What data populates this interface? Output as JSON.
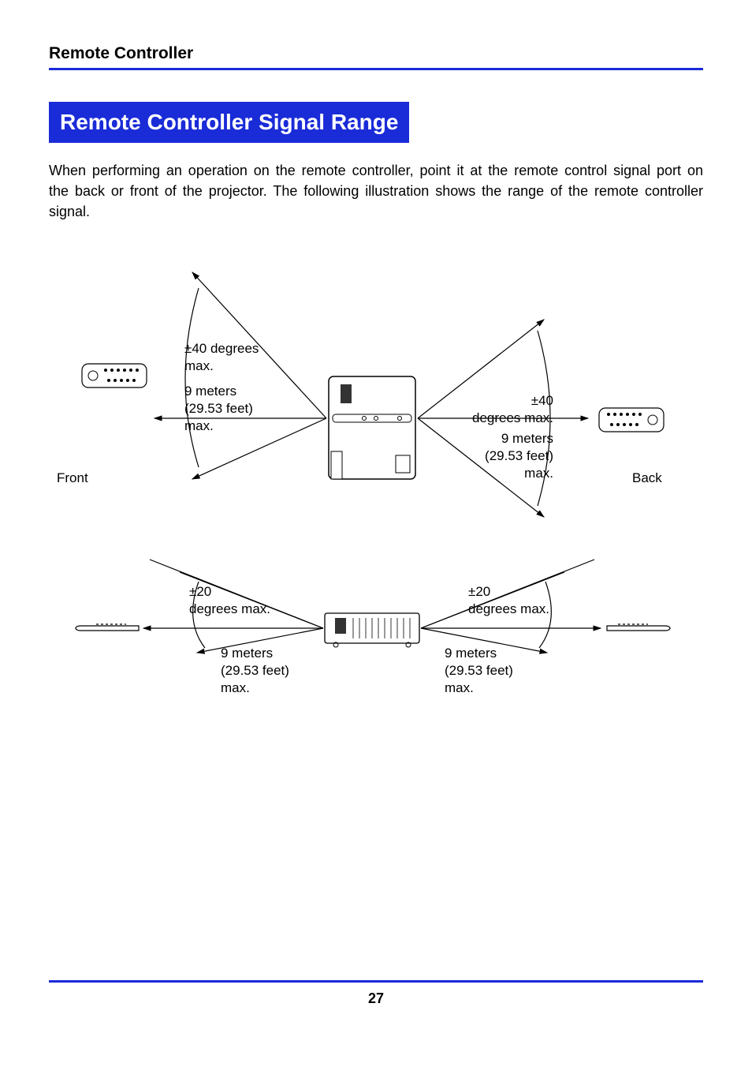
{
  "header": {
    "running_head": "Remote Controller"
  },
  "title": "Remote Controller Signal Range",
  "body": "When performing an operation on the remote controller, point it at the remote control signal port on the back or front of the projector. The following illustration shows the range of the remote controller signal.",
  "labels": {
    "front": "Front",
    "back": "Back",
    "front_angle": "±40 degrees\nmax.",
    "front_dist": "9 meters\n(29.53 feet)\nmax.",
    "back_angle": "±40\ndegrees max.",
    "back_dist": "9 meters\n(29.53 feet)\nmax.",
    "side_left_angle": "±20\ndegrees max.",
    "side_left_dist": "9 meters\n(29.53 feet)\nmax.",
    "side_right_angle": "±20\ndegrees max.",
    "side_right_dist": "9 meters\n(29.53 feet)\nmax."
  },
  "page_number": "27",
  "colors": {
    "brand_blue": "#1a2bd8"
  }
}
